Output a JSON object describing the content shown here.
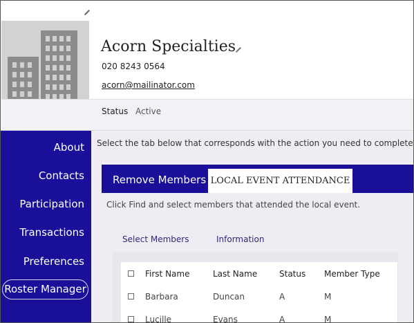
{
  "organization": {
    "name": "Acorn Specialties",
    "phone": "020 8243 0564",
    "email": "acorn@mailinator.com",
    "status_label": "Status",
    "status_value": "Active"
  },
  "sidebar": {
    "items": [
      {
        "label": "About"
      },
      {
        "label": "Contacts"
      },
      {
        "label": "Participation"
      },
      {
        "label": "Transactions"
      },
      {
        "label": "Preferences"
      },
      {
        "label": "Roster Manager"
      }
    ]
  },
  "main": {
    "instruction": "Select the tab below that corresponds with the action you need to complete",
    "tabs": [
      {
        "label": "Remove Members"
      },
      {
        "label": "LOCAL EVENT ATTENDANCE"
      }
    ],
    "panel_text": "Click Find and select members that attended the local event.",
    "subtabs": [
      {
        "label": "Select Members"
      },
      {
        "label": "Information"
      }
    ],
    "table": {
      "columns": [
        "First Name",
        "Last Name",
        "Status",
        "Member Type"
      ],
      "rows": [
        [
          "Barbara",
          "Duncan",
          "A",
          "M"
        ],
        [
          "Lucille",
          "Evans",
          "A",
          "M"
        ]
      ]
    }
  },
  "colors": {
    "brand_navy": "#1a0f98",
    "background": "#efedf3"
  },
  "icons": [
    "building-icon",
    "pencil-icon"
  ]
}
